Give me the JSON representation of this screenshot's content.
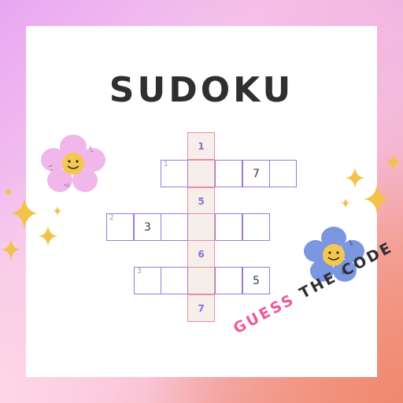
{
  "title": "SUDOKU",
  "footer": {
    "highlight": "GUESS",
    "rest": " THE CODE"
  },
  "key_column": [
    "1",
    "",
    "5",
    "",
    "6",
    "",
    "7"
  ],
  "rows": [
    {
      "clue": "1",
      "cells": [
        "",
        "",
        "",
        "7",
        ""
      ]
    },
    {
      "clue": "2",
      "cells": [
        "",
        "3",
        "",
        "",
        "",
        ""
      ]
    },
    {
      "clue": "3",
      "cells": [
        "",
        "",
        "",
        "",
        "5"
      ]
    }
  ],
  "colors": {
    "cell_border": "#9a7ad9",
    "key_border": "#e98aae",
    "key_fill": "#f6efe9",
    "accent_pink": "#f2579d",
    "sparkle": "#f2c24a"
  },
  "icons": [
    "pink-flower-icon",
    "blue-flower-icon",
    "sparkle-icon"
  ]
}
